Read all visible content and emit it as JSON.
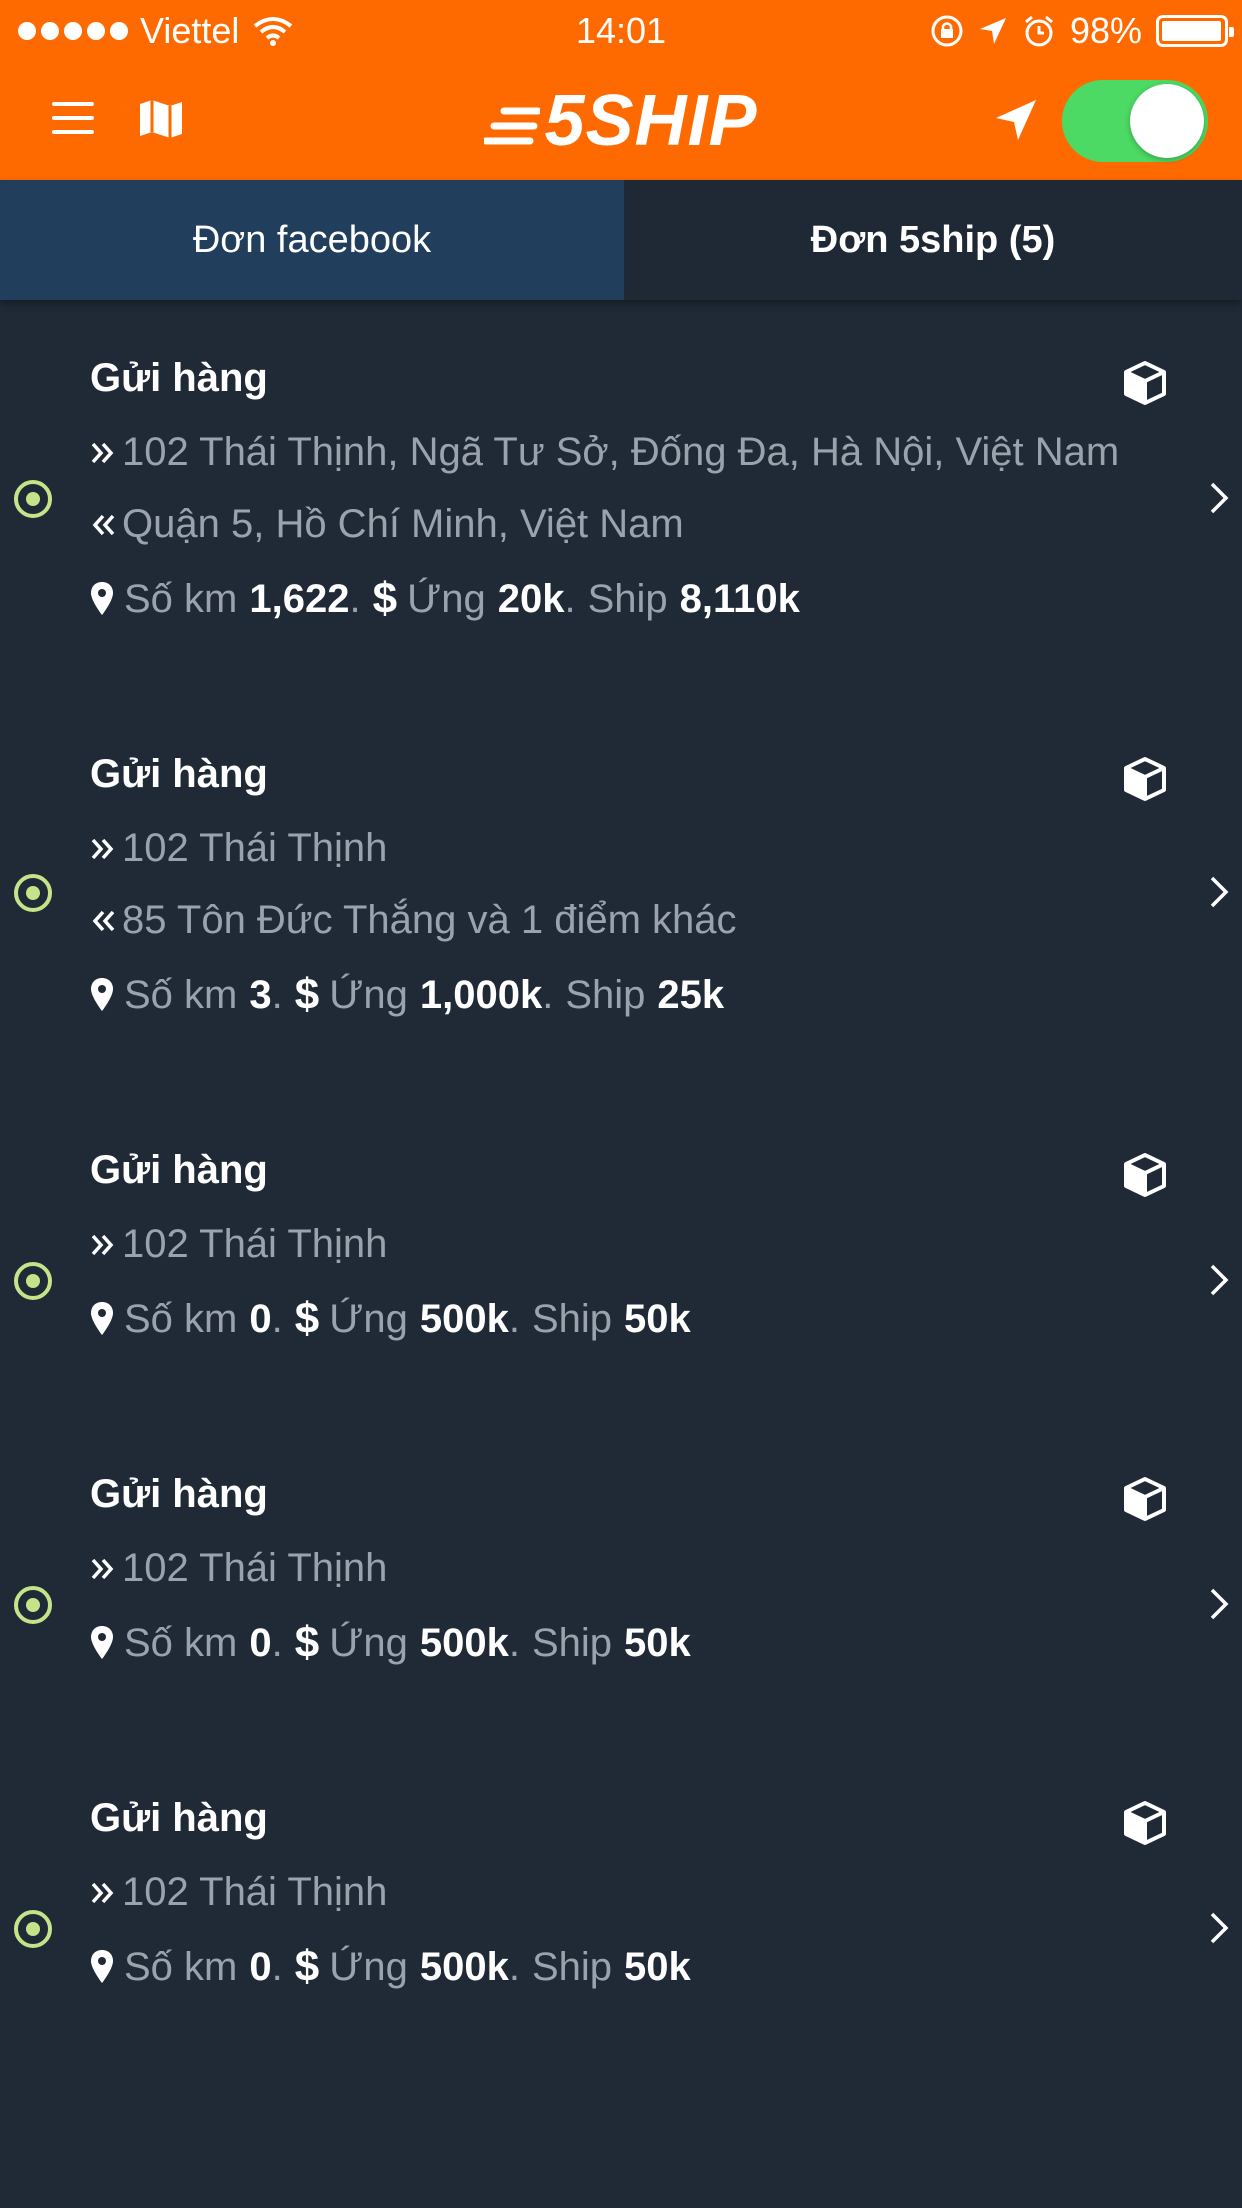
{
  "status_bar": {
    "carrier": "Viettel",
    "time": "14:01",
    "battery_text": "98%",
    "battery_level": 0.98
  },
  "nav": {
    "logo": "5SHIP",
    "location_toggle_on": true,
    "toggle_color": "#4cd964"
  },
  "colors": {
    "header": "#ff6a00",
    "background": "#202a36",
    "tab_active": "#213e5c",
    "bullet": "#c5e48a"
  },
  "tabs": [
    {
      "label": "Đơn facebook"
    },
    {
      "label": "Đơn 5ship (5)"
    }
  ],
  "orders": [
    {
      "title": "Gửi hàng",
      "pickup": "102 Thái Thịnh, Ngã Tư Sở, Đống Đa, Hà Nội, Việt Nam",
      "dropoff": "Quận 5, Hồ Chí Minh, Việt Nam",
      "km_label": "Số km",
      "km": "1,622",
      "advance_label": "Ứng",
      "advance": "20k",
      "ship_label": "Ship",
      "ship": "8,110k"
    },
    {
      "title": "Gửi hàng",
      "pickup": "102 Thái Thịnh",
      "dropoff": "85 Tôn Đức Thắng và 1 điểm khác",
      "km_label": "Số km",
      "km": "3",
      "advance_label": "Ứng",
      "advance": "1,000k",
      "ship_label": "Ship",
      "ship": "25k"
    },
    {
      "title": "Gửi hàng",
      "pickup": "102 Thái Thịnh",
      "km_label": "Số km",
      "km": "0",
      "advance_label": "Ứng",
      "advance": "500k",
      "ship_label": "Ship",
      "ship": "50k"
    },
    {
      "title": "Gửi hàng",
      "pickup": "102 Thái Thịnh",
      "km_label": "Số km",
      "km": "0",
      "advance_label": "Ứng",
      "advance": "500k",
      "ship_label": "Ship",
      "ship": "50k"
    },
    {
      "title": "Gửi hàng",
      "pickup": "102 Thái Thịnh",
      "km_label": "Số km",
      "km": "0",
      "advance_label": "Ứng",
      "advance": "500k",
      "ship_label": "Ship",
      "ship": "50k"
    }
  ],
  "icons": {
    "menu": "hamburger-menu-icon",
    "map": "map-icon",
    "location": "location-arrow-icon",
    "package": "package-box-icon",
    "pickup": "double-chevron-right-icon",
    "dropoff": "double-chevron-left-icon",
    "pin": "map-pin-icon",
    "dollar": "dollar-icon",
    "chevron": "chevron-right-icon",
    "bullet": "target-bullet-icon"
  }
}
